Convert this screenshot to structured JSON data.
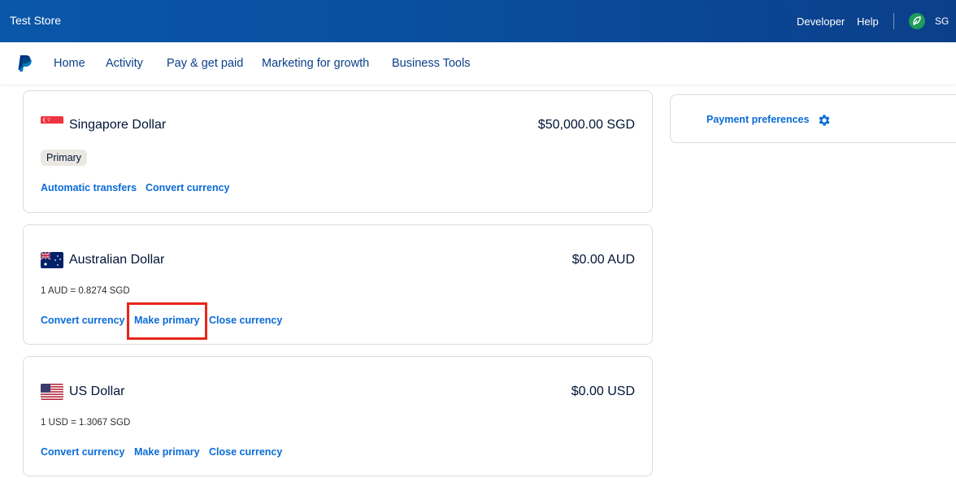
{
  "topbar": {
    "store_name": "Test Store",
    "links": {
      "developer": "Developer",
      "help": "Help"
    },
    "user_initials": "SG"
  },
  "nav": {
    "items": [
      "Home",
      "Activity",
      "Pay & get paid",
      "Marketing for growth",
      "Business Tools"
    ]
  },
  "currencies": [
    {
      "name": "Singapore Dollar",
      "amount": "$50,000.00 SGD",
      "badge": "Primary",
      "flag": "singapore-flag",
      "actions": [
        "Automatic transfers",
        "Convert currency"
      ]
    },
    {
      "name": "Australian Dollar",
      "amount": "$0.00 AUD",
      "rate": "1 AUD = 0.8274 SGD",
      "flag": "australia-flag",
      "actions": [
        "Convert currency",
        "Make primary",
        "Close currency"
      ]
    },
    {
      "name": "US Dollar",
      "amount": "$0.00 USD",
      "rate": "1 USD = 1.3067 SGD",
      "flag": "usa-flag",
      "actions": [
        "Convert currency",
        "Make primary",
        "Close currency"
      ]
    }
  ],
  "sidebar": {
    "payment_preferences": "Payment preferences"
  },
  "colors": {
    "topbar": "#0a56a8",
    "link": "#0a6bd6",
    "highlight": "#e8261a",
    "avatar": "#1f9c5a"
  }
}
